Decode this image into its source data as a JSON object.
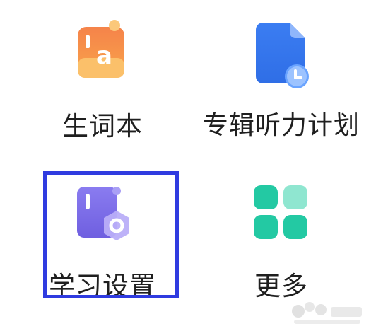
{
  "grid": {
    "items": [
      {
        "label": "生词本",
        "icon": "vocabulary-book-icon",
        "color": "#f7954a"
      },
      {
        "label": "专辑听力计划",
        "icon": "album-listening-plan-icon",
        "color": "#3b7df2"
      },
      {
        "label": "学习设置",
        "icon": "study-settings-icon",
        "color": "#7b6fe8"
      },
      {
        "label": "更多",
        "icon": "more-grid-icon",
        "color": "#23c9a3"
      }
    ],
    "selected_index": 2
  },
  "colors": {
    "highlight_border": "#2f3be0",
    "text": "#1f1f1f"
  }
}
